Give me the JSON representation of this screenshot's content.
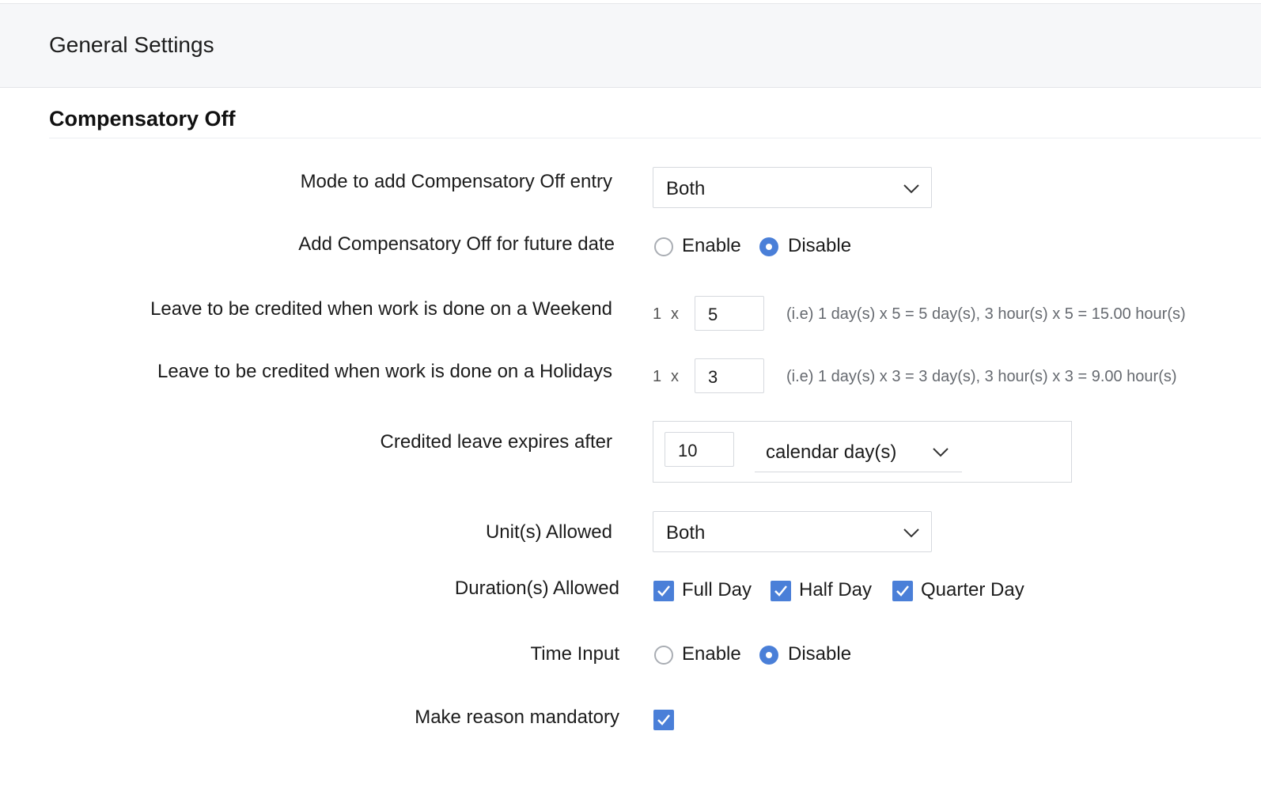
{
  "header": {
    "title": "General Settings"
  },
  "section": {
    "title": "Compensatory Off"
  },
  "fields": {
    "mode": {
      "label": "Mode to add Compensatory Off entry",
      "value": "Both"
    },
    "future_date": {
      "label": "Add Compensatory Off for future date",
      "options": [
        "Enable",
        "Disable"
      ],
      "selected": "Disable"
    },
    "weekend": {
      "label": "Leave to be credited when work is done on a Weekend",
      "base": "1",
      "times": "x",
      "value": "5",
      "hint": "(i.e) 1 day(s) x 5 = 5 day(s), 3 hour(s) x 5 = 15.00 hour(s)"
    },
    "holidays": {
      "label": "Leave to be credited when work is done on a Holidays",
      "base": "1",
      "times": "x",
      "value": "3",
      "hint": "(i.e) 1 day(s) x 3 = 3 day(s), 3 hour(s) x 3 = 9.00 hour(s)"
    },
    "expires": {
      "label": "Credited leave expires after",
      "value": "10",
      "unit": "calendar day(s)"
    },
    "units": {
      "label": "Unit(s) Allowed",
      "value": "Both"
    },
    "durations": {
      "label": "Duration(s) Allowed",
      "options": [
        "Full Day",
        "Half Day",
        "Quarter Day"
      ],
      "checked": [
        true,
        true,
        true
      ]
    },
    "time_input": {
      "label": "Time Input",
      "options": [
        "Enable",
        "Disable"
      ],
      "selected": "Disable"
    },
    "reason_mandatory": {
      "label": "Make reason mandatory",
      "checked": true
    }
  },
  "colors": {
    "accent": "#4a7fd8",
    "header_bg": "#f6f7f9",
    "border": "#d6d9de"
  },
  "icons": {
    "dropdown": "chevron-down-icon",
    "check": "checkmark-icon"
  }
}
